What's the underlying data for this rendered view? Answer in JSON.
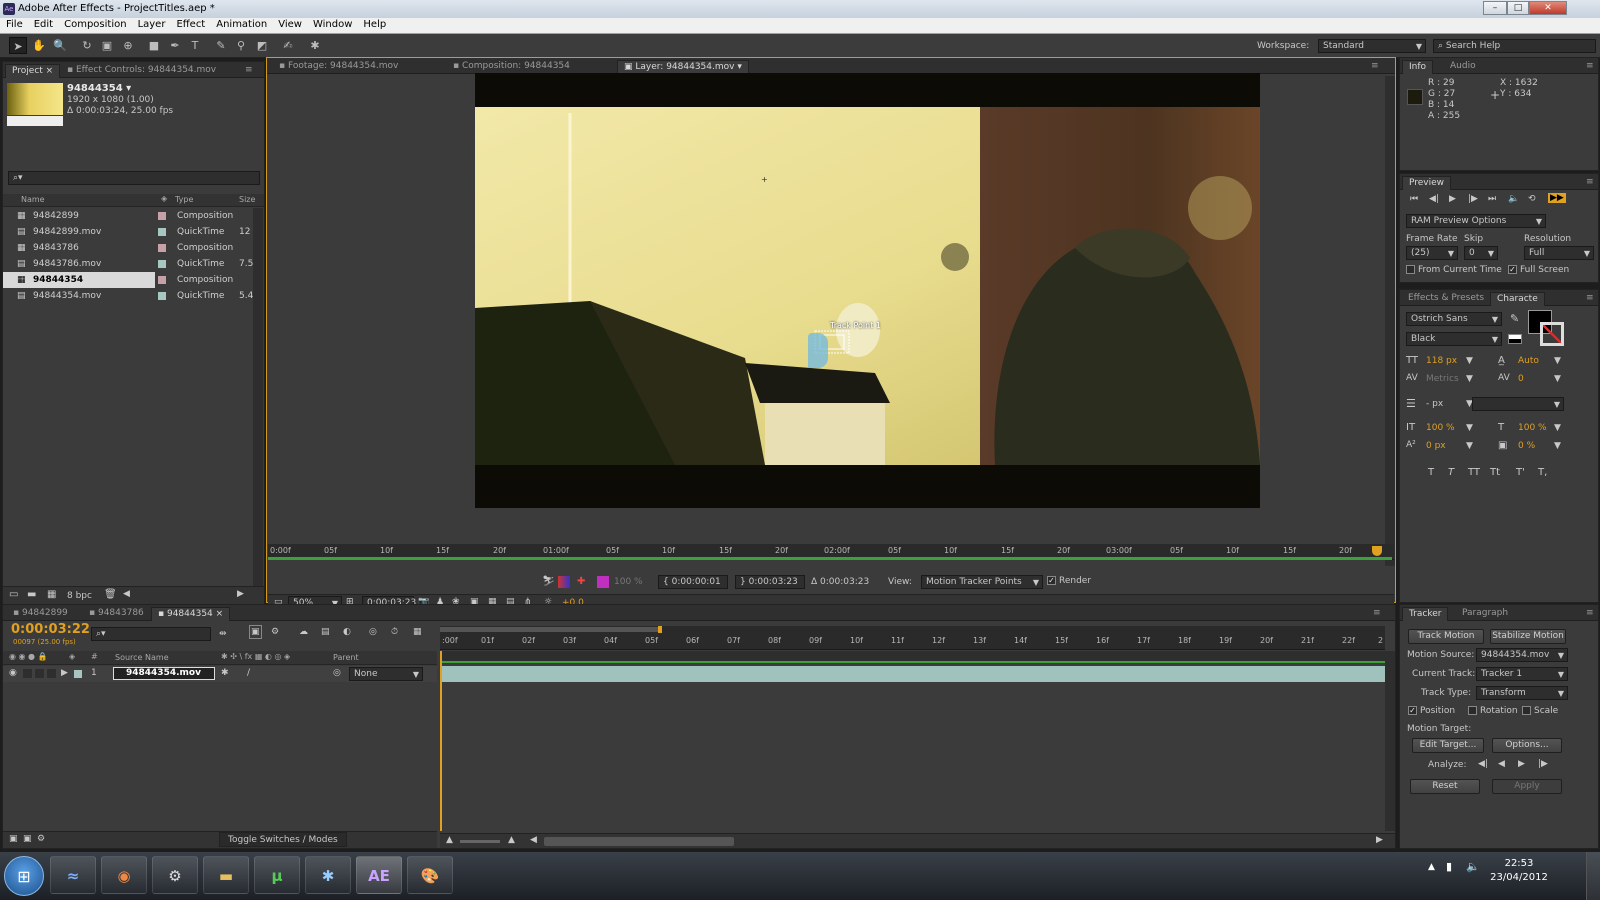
{
  "window": {
    "title": "Adobe After Effects - ProjectTitles.aep *",
    "app_icon": "Ae",
    "min": "–",
    "max": "□",
    "close": "✕"
  },
  "menu": [
    "File",
    "Edit",
    "Composition",
    "Layer",
    "Effect",
    "Animation",
    "View",
    "Window",
    "Help"
  ],
  "toolbar": {
    "workspace_label": "Workspace:",
    "workspace_value": "Standard",
    "search_placeholder": "Search Help"
  },
  "project": {
    "tabs": [
      "Project",
      "Effect Controls: 94844354.mov"
    ],
    "selected_name": "94844354 ▾",
    "selected_info1": "1920 x 1080 (1.00)",
    "selected_info2": "Δ 0:00:03:24, 25.00 fps",
    "search_placeholder": "",
    "columns": [
      "Name",
      "Type",
      "Size"
    ],
    "items": [
      {
        "name": "94842899",
        "type": "Composition",
        "size": ""
      },
      {
        "name": "94842899.mov",
        "type": "QuickTime",
        "size": "12"
      },
      {
        "name": "94843786",
        "type": "Composition",
        "size": ""
      },
      {
        "name": "94843786.mov",
        "type": "QuickTime",
        "size": "7.5"
      },
      {
        "name": "94844354",
        "type": "Composition",
        "size": ""
      },
      {
        "name": "94844354.mov",
        "type": "QuickTime",
        "size": "5.4"
      }
    ],
    "bpc": "8 bpc"
  },
  "viewer": {
    "tabs": [
      "Footage: 94844354.mov",
      "Composition: 94844354",
      "Layer: 94844354.mov"
    ],
    "track_point_label": "Track Point 1",
    "ruler_ticks": [
      "0:00f",
      "05f",
      "10f",
      "15f",
      "20f",
      "01:00f",
      "05f",
      "10f",
      "15f",
      "20f",
      "02:00f",
      "05f",
      "10f",
      "15f",
      "20f",
      "03:00f",
      "05f",
      "10f",
      "15f",
      "20f"
    ],
    "opacity": "100 %",
    "in_time": "0:00:00:01",
    "out_time": "0:00:03:23",
    "duration": "Δ 0:00:03:23",
    "view_label": "View:",
    "view_value": "Motion Tracker Points",
    "render_label": "Render",
    "zoom": "50%",
    "current_time": "0:00:03:23",
    "exposure": "+0.0"
  },
  "info": {
    "tabs": [
      "Info",
      "Audio"
    ],
    "r": "R : 29",
    "g": "G : 27",
    "b": "B : 14",
    "a": "A : 255",
    "x": "X : 1632",
    "y": "Y : 634",
    "swatch_color": "#1d1b0e"
  },
  "preview": {
    "title": "Preview",
    "ram_options": "RAM Preview Options",
    "frame_rate_label": "Frame Rate",
    "skip_label": "Skip",
    "resolution_label": "Resolution",
    "frame_rate": "(25)",
    "skip": "0",
    "resolution": "Full",
    "from_current": "From Current Time",
    "full_screen": "Full Screen"
  },
  "character": {
    "tabs": [
      "Effects & Presets",
      "Characte"
    ],
    "font": "Ostrich Sans",
    "style": "Black",
    "size": "118 px",
    "leading": "Auto",
    "kerning": "Metrics",
    "tracking": "0",
    "stroke": "- px",
    "vscale": "100 %",
    "hscale": "100 %",
    "baseline": "0 px",
    "tsume": "0 %",
    "styles": [
      "T",
      "T",
      "TT",
      "Tt",
      "T'",
      "T,"
    ]
  },
  "timeline": {
    "tabs": [
      "94842899",
      "94843786",
      "94844354"
    ],
    "time": "0:00:03:22",
    "frame_info": "00097 (25.00 fps)",
    "search_placeholder": "",
    "col_source": "Source Name",
    "col_parent": "Parent",
    "layer_num": "1",
    "layer_name": "94844354.mov",
    "layer_parent": "None",
    "ticks": [
      ":00f",
      "01f",
      "02f",
      "03f",
      "04f",
      "05f",
      "06f",
      "07f",
      "08f",
      "09f",
      "10f",
      "11f",
      "12f",
      "13f",
      "14f",
      "15f",
      "16f",
      "17f",
      "18f",
      "19f",
      "20f",
      "21f",
      "22f",
      "2"
    ],
    "toggle_label": "Toggle Switches / Modes"
  },
  "tracker": {
    "tabs": [
      "Tracker",
      "Paragraph"
    ],
    "track_motion": "Track Motion",
    "stabilize_motion": "Stabilize Motion",
    "motion_source_label": "Motion Source:",
    "motion_source": "94844354.mov",
    "current_track_label": "Current Track:",
    "current_track": "Tracker 1",
    "track_type_label": "Track Type:",
    "track_type": "Transform",
    "position": "Position",
    "rotation": "Rotation",
    "scale": "Scale",
    "motion_target_label": "Motion Target:",
    "edit_target": "Edit Target...",
    "options": "Options...",
    "analyze_label": "Analyze:",
    "reset": "Reset",
    "apply": "Apply"
  },
  "taskbar": {
    "apps": [
      "start-orb",
      "windows-live",
      "chrome",
      "steam",
      "explorer",
      "utorrent",
      "rainmeter",
      "after-effects",
      "paint"
    ],
    "ae_label": "AE",
    "clock_time": "22:53",
    "clock_date": "23/04/2012"
  }
}
